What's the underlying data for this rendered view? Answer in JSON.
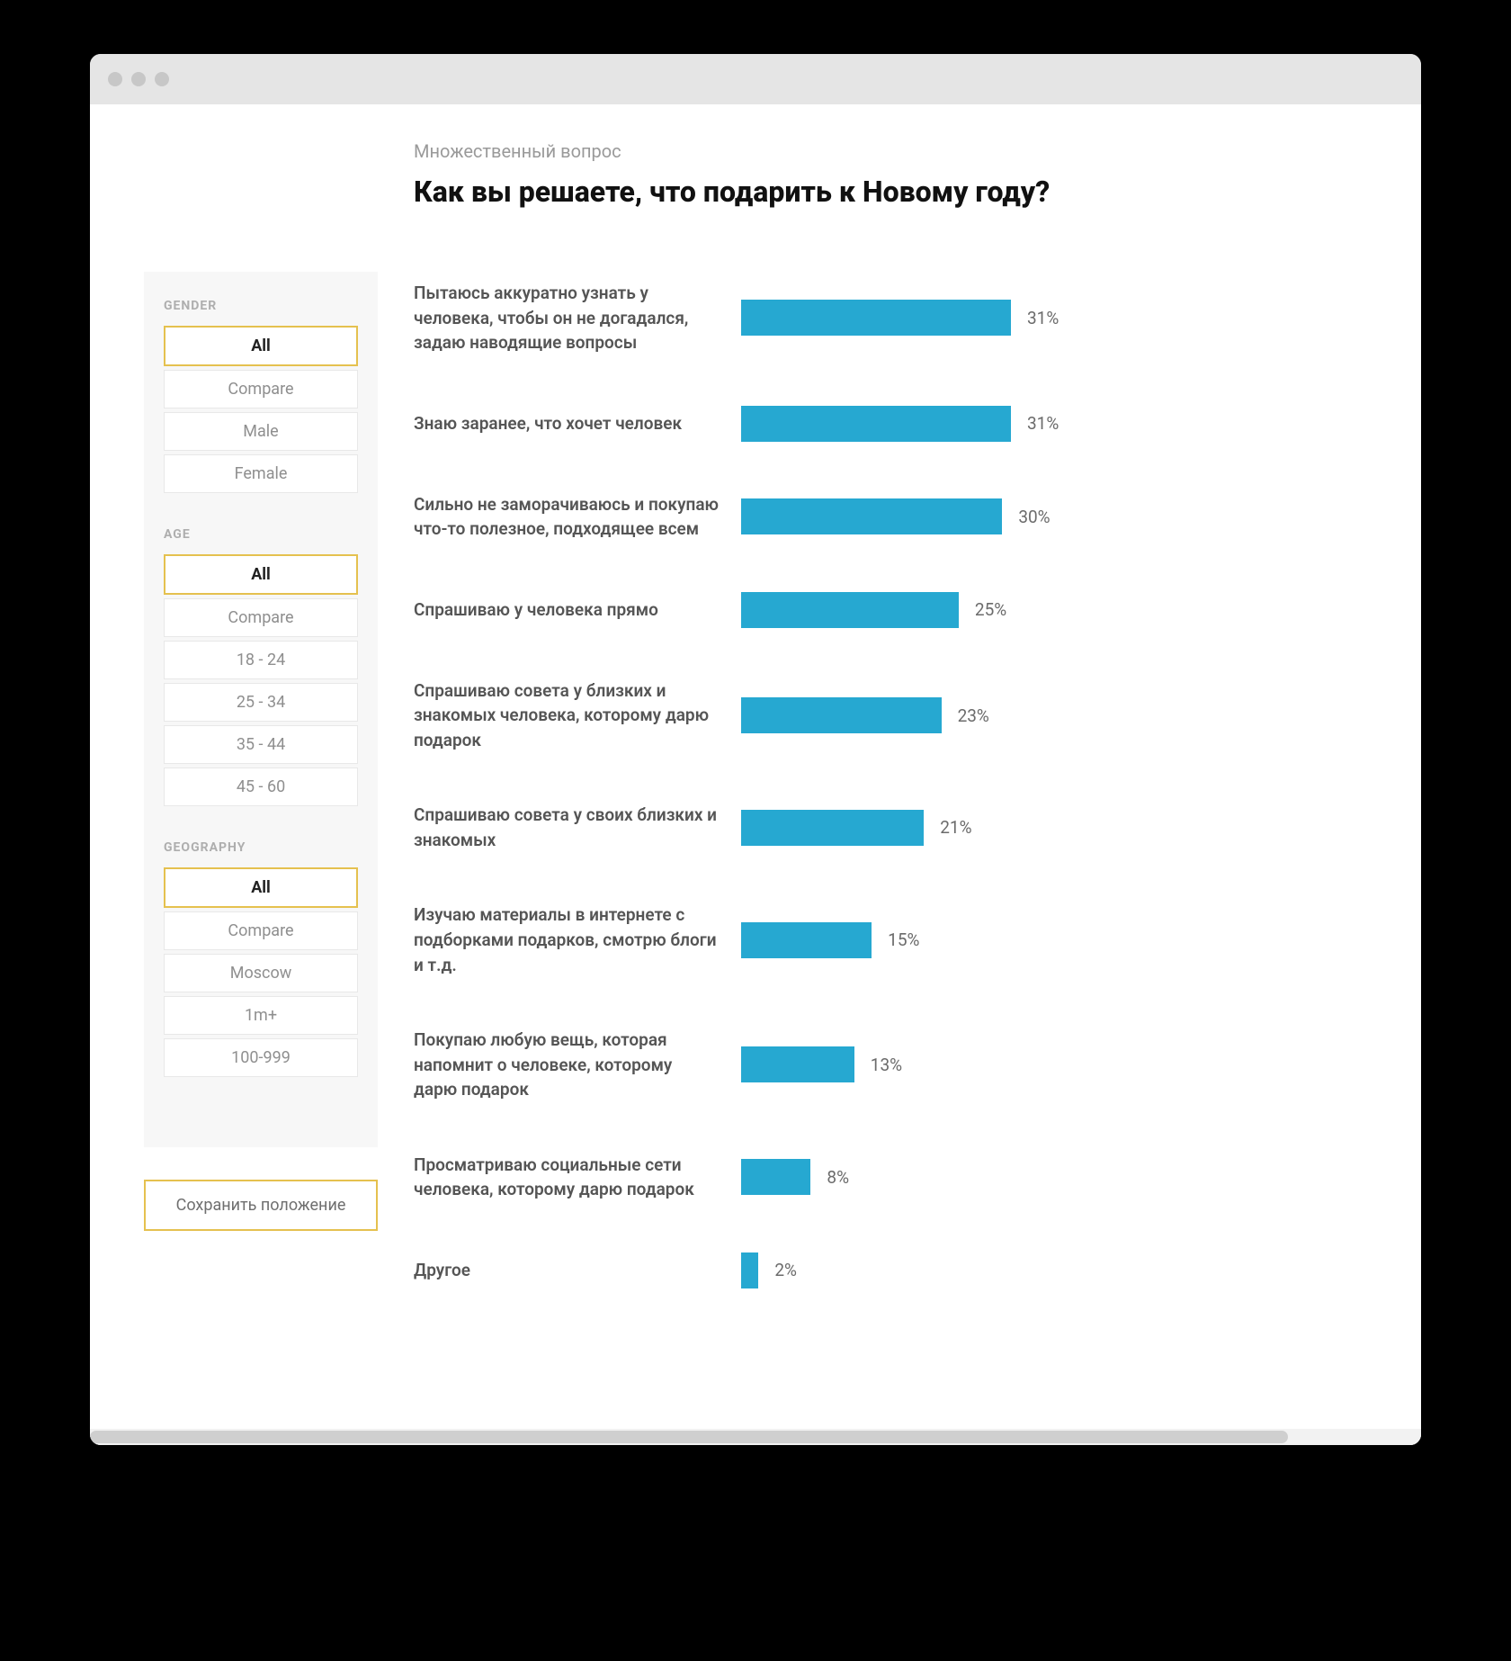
{
  "window": {
    "subtitle": "Множественный вопрос",
    "title": "Как вы решаете, что подарить к Новому году?",
    "save_button": "Сохранить положение"
  },
  "filters": [
    {
      "label": "GENDER",
      "options": [
        {
          "label": "All",
          "active": true
        },
        {
          "label": "Compare",
          "active": false
        },
        {
          "label": "Male",
          "active": false
        },
        {
          "label": "Female",
          "active": false
        }
      ]
    },
    {
      "label": "AGE",
      "options": [
        {
          "label": "All",
          "active": true
        },
        {
          "label": "Compare",
          "active": false
        },
        {
          "label": "18 - 24",
          "active": false
        },
        {
          "label": "25 - 34",
          "active": false
        },
        {
          "label": "35 - 44",
          "active": false
        },
        {
          "label": "45 - 60",
          "active": false
        }
      ]
    },
    {
      "label": "GEOGRAPHY",
      "options": [
        {
          "label": "All",
          "active": true
        },
        {
          "label": "Compare",
          "active": false
        },
        {
          "label": "Moscow",
          "active": false
        },
        {
          "label": "1m+",
          "active": false
        },
        {
          "label": "100-999",
          "active": false
        }
      ]
    }
  ],
  "chart_data": {
    "type": "bar",
    "title": "Как вы решаете, что подарить к Новому году?",
    "xlabel": "",
    "ylabel": "",
    "ylim": [
      0,
      100
    ],
    "categories": [
      "Пытаюсь аккуратно узнать у человека, чтобы он не догадался, задаю наводящие вопросы",
      "Знаю заранее, что хочет человек",
      "Сильно не заморачиваюсь и покупаю что-то полезное, подходящее всем",
      "Спрашиваю у человека прямо",
      "Спрашиваю совета у близких и знакомых человека, которому дарю подарок",
      "Спрашиваю совета у своих близких и знакомых",
      "Изучаю материалы в интернете с подборками подарков, смотрю блоги и т.д.",
      "Покупаю любую вещь, которая напомнит о человеке, которому дарю подарок",
      "Просматриваю социальные сети человека, которому дарю подарок",
      "Другое"
    ],
    "values": [
      31,
      31,
      30,
      25,
      23,
      21,
      15,
      13,
      8,
      2
    ],
    "value_suffix": "%",
    "bar_color": "#26a8d1"
  }
}
